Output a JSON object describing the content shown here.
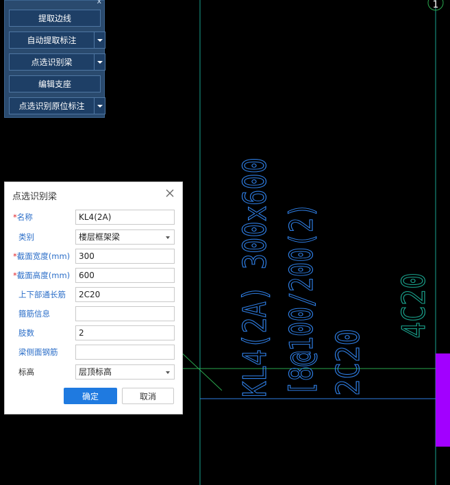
{
  "colors": {
    "canvas_bg": "#000000",
    "panel_bg": "#2a4a6e",
    "button_bg": "#1e3f66",
    "annotation_blue": "#2f7fe6",
    "annotation_teal": "#1aa58f",
    "axis_green": "#2aa94f",
    "accent_purple": "#a200ff",
    "primary_button": "#1f7ae0",
    "required_asterisk": "#e0262c",
    "label_blue": "#2b6ec8"
  },
  "toolbar": {
    "close_glyph": "x",
    "buttons": [
      {
        "label": "提取边线",
        "has_dropdown": false
      },
      {
        "label": "自动提取标注",
        "has_dropdown": true
      },
      {
        "label": "点选识别梁",
        "has_dropdown": true
      },
      {
        "label": "编辑支座",
        "has_dropdown": false
      },
      {
        "label": "点选识别原位标注",
        "has_dropdown": true
      }
    ]
  },
  "cad": {
    "axis_marker": "1",
    "beam_label": "KL4(2A) 300x600",
    "stirrup_label": "[8@100/200(2)",
    "top_bar_label": "2C20",
    "side_label": "4C20"
  },
  "dialog": {
    "title": "点选识别梁",
    "required_mark": "*",
    "fields": [
      {
        "label": "名称",
        "required": true,
        "value": "KL4(2A)",
        "type": "text"
      },
      {
        "label": "类别",
        "required": false,
        "value": "楼层框架梁",
        "type": "select"
      },
      {
        "label": "截面宽度(mm)",
        "required": true,
        "value": "300",
        "type": "text"
      },
      {
        "label": "截面高度(mm)",
        "required": true,
        "value": "600",
        "type": "text"
      },
      {
        "label": "上下部通长筋",
        "required": false,
        "value": "2C20",
        "type": "text"
      },
      {
        "label": "箍筋信息",
        "required": false,
        "value": "",
        "type": "text"
      },
      {
        "label": "肢数",
        "required": false,
        "value": "2",
        "type": "text"
      },
      {
        "label": "梁侧面钢筋",
        "required": false,
        "value": "",
        "type": "text"
      },
      {
        "label": "标高",
        "required": false,
        "value": "层顶标高",
        "type": "select"
      }
    ],
    "ok_label": "确定",
    "cancel_label": "取消"
  }
}
